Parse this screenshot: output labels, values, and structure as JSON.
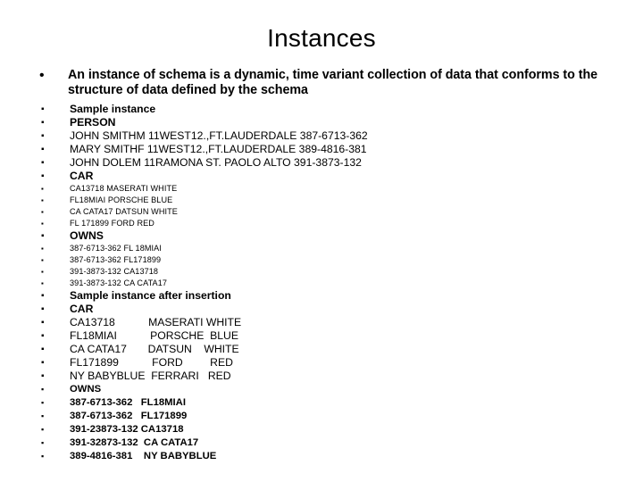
{
  "slide": {
    "title": "Instances",
    "background_color": "#ffffff",
    "text_color": "#000000",
    "bullet_glyph": "•",
    "bullet_glyph_small": "▪"
  },
  "intro_bullet": {
    "text": "An instance of schema is a dynamic, time variant collection of data that conforms to the structure of data defined by the schema"
  },
  "section_labels": {
    "sample_instance": "Sample instance",
    "person": "PERSON",
    "car": "CAR",
    "owns": "OWNS",
    "sample_instance_after_insertion": "Sample instance after insertion",
    "car2": "CAR",
    "owns2": "OWNS"
  },
  "person_rows": [
    "JOHN SMITHM 11WEST12.,FT.LAUDERDALE 387-6713-362",
    "MARY SMITHF 11WEST12.,FT.LAUDERDALE 389-4816-381",
    "JOHN DOLEM 11RAMONA ST. PAOLO ALTO 391-3873-132"
  ],
  "car_rows": [
    "CA13718 MASERATI WHITE",
    "FL18MIAI PORSCHE BLUE",
    "CA CATA17 DATSUN WHITE",
    "FL 171899 FORD RED"
  ],
  "owns_rows": [
    "387-6713-362 FL 18MIAI",
    "387-6713-362 FL171899",
    "391-3873-132 CA13718",
    "391-3873-132 CA CATA17"
  ],
  "car_rows_after": [
    "CA13718           MASERATI WHITE",
    "FL18MIAI           PORSCHE  BLUE",
    "CA CATA17       DATSUN    WHITE",
    "FL171899           FORD         RED",
    "NY BABYBLUE  FERRARI   RED"
  ],
  "owns_rows_after": [
    "387-6713-362   FL18MIAI",
    "387-6713-362   FL171899",
    "391-23873-132 CA13718",
    "391-32873-132  CA CATA17",
    "389-4816-381    NY BABYBLUE"
  ]
}
